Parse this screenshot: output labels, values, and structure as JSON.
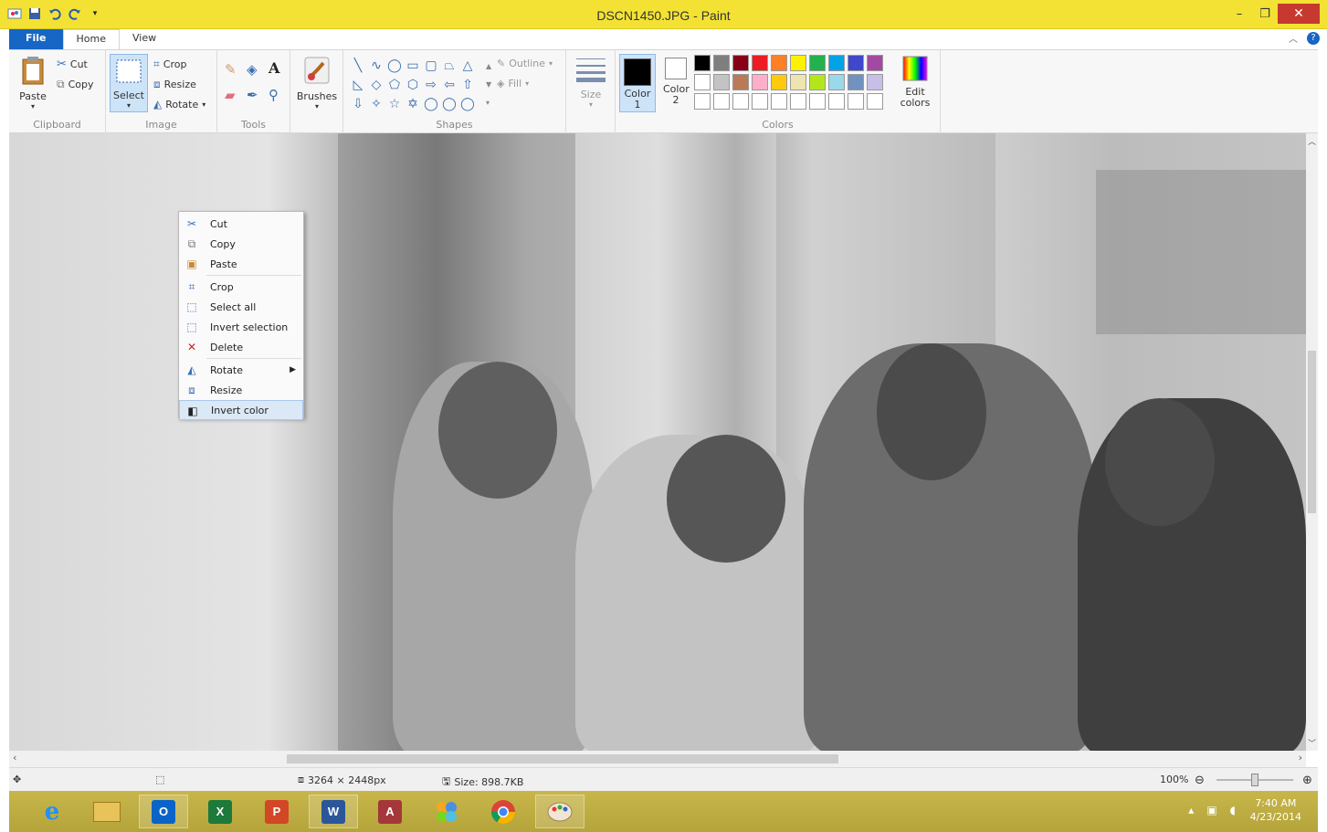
{
  "window": {
    "title": "DSCN1450.JPG - Paint",
    "minimize": "–",
    "restore": "❐",
    "close": "✕"
  },
  "ribbon_tabs": [
    "File",
    "Home",
    "View"
  ],
  "clipboard": {
    "paste": "Paste",
    "cut": "Cut",
    "copy": "Copy",
    "group_label": "Clipboard"
  },
  "image": {
    "select": "Select",
    "crop": "Crop",
    "resize": "Resize",
    "rotate": "Rotate",
    "group_label": "Image"
  },
  "tools": {
    "group_label": "Tools"
  },
  "brushes": {
    "label": "Brushes"
  },
  "shapes": {
    "outline": "Outline",
    "fill": "Fill",
    "group_label": "Shapes",
    "glyphs": [
      "╲",
      "∿",
      "◯",
      "▭",
      "▢",
      "⏢",
      "△",
      "◺",
      "◇",
      "⬠",
      "⬡",
      "⇨",
      "⇦",
      "⇧",
      "⇩",
      "✧",
      "☆",
      "✡",
      "◯",
      "◯",
      "◯"
    ]
  },
  "size": {
    "label": "Size"
  },
  "colors": {
    "color1": "Color 1",
    "color2": "Color 2",
    "edit": "Edit colors",
    "group_label": "Colors",
    "color1_value": "#000000",
    "color2_value": "#ffffff",
    "palette": [
      "#000000",
      "#7f7f7f",
      "#880015",
      "#ed1c24",
      "#ff7f27",
      "#fff200",
      "#22b14c",
      "#00a2e8",
      "#3f48cc",
      "#a349a4",
      "#ffffff",
      "#c3c3c3",
      "#b97a57",
      "#ffaec9",
      "#ffc90e",
      "#efe4b0",
      "#b5e61d",
      "#99d9ea",
      "#7092be",
      "#c8bfe7",
      "#ffffff",
      "#ffffff",
      "#ffffff",
      "#ffffff",
      "#ffffff",
      "#ffffff",
      "#ffffff",
      "#ffffff",
      "#ffffff",
      "#ffffff"
    ]
  },
  "context_menu": {
    "items": [
      {
        "label": "Cut",
        "icon": "scissors-icon"
      },
      {
        "label": "Copy",
        "icon": "copy-icon"
      },
      {
        "label": "Paste",
        "icon": "paste-icon"
      },
      {
        "label": "Crop",
        "icon": "crop-icon"
      },
      {
        "label": "Select all",
        "icon": "select-all-icon"
      },
      {
        "label": "Invert selection",
        "icon": "invert-selection-icon"
      },
      {
        "label": "Delete",
        "icon": "delete-icon"
      },
      {
        "label": "Rotate",
        "icon": "rotate-icon"
      },
      {
        "label": "Resize",
        "icon": "resize-icon"
      },
      {
        "label": "Invert color",
        "icon": "invert-color-icon"
      }
    ]
  },
  "status": {
    "dimensions": "3264 × 2448px",
    "size": "Size: 898.7KB",
    "zoom": "100%"
  },
  "taskbar": {
    "time": "7:40 AM",
    "date": "4/23/2014",
    "apps": [
      "internet-explorer",
      "file-explorer",
      "outlook",
      "excel",
      "powerpoint",
      "word",
      "access",
      "photo-gallery",
      "chrome",
      "paint"
    ]
  }
}
